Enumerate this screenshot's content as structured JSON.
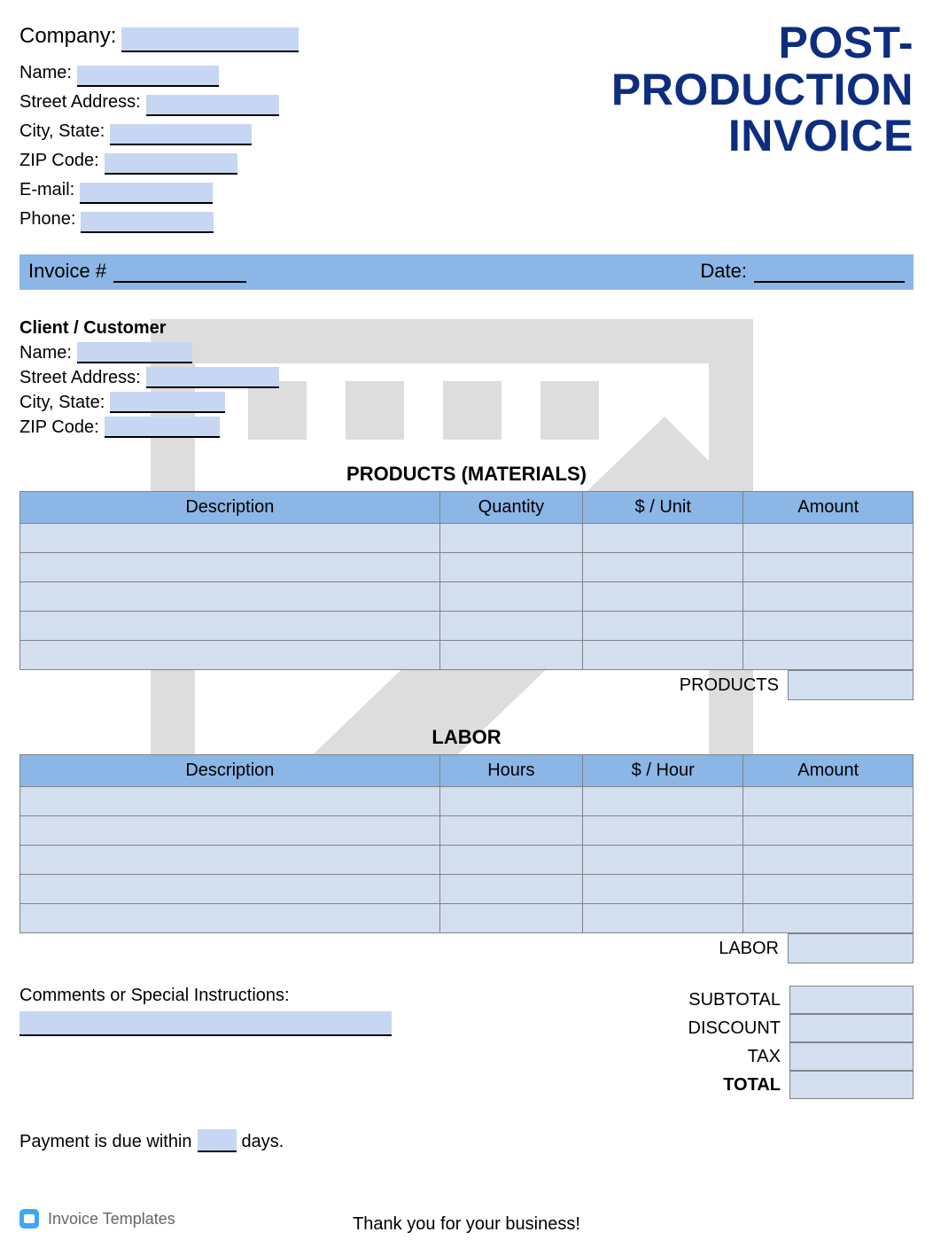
{
  "title_lines": [
    "POST-",
    "PRODUCTION",
    "INVOICE"
  ],
  "company": {
    "company_label": "Company:",
    "name_label": "Name:",
    "street_label": "Street Address:",
    "city_label": "City, State:",
    "zip_label": "ZIP Code:",
    "email_label": "E-mail:",
    "phone_label": "Phone:"
  },
  "invoice_bar": {
    "invoice_label": "Invoice #",
    "date_label": "Date:"
  },
  "client": {
    "heading": "Client / Customer",
    "name_label": "Name:",
    "street_label": "Street Address:",
    "city_label": "City, State:",
    "zip_label": "ZIP Code:"
  },
  "products": {
    "title": "PRODUCTS (MATERIALS)",
    "cols": {
      "c1": "Description",
      "c2": "Quantity",
      "c3": "$ / Unit",
      "c4": "Amount"
    },
    "subtotal_label": "PRODUCTS"
  },
  "labor": {
    "title": "LABOR",
    "cols": {
      "c1": "Description",
      "c2": "Hours",
      "c3": "$ / Hour",
      "c4": "Amount"
    },
    "subtotal_label": "LABOR"
  },
  "comments_label": "Comments or Special Instructions:",
  "totals": {
    "subtotal": "SUBTOTAL",
    "discount": "DISCOUNT",
    "tax": "TAX",
    "total": "TOTAL"
  },
  "payment": {
    "pre": "Payment is due within",
    "post": "days."
  },
  "thanks": "Thank you for your business!",
  "footer": "Invoice Templates"
}
